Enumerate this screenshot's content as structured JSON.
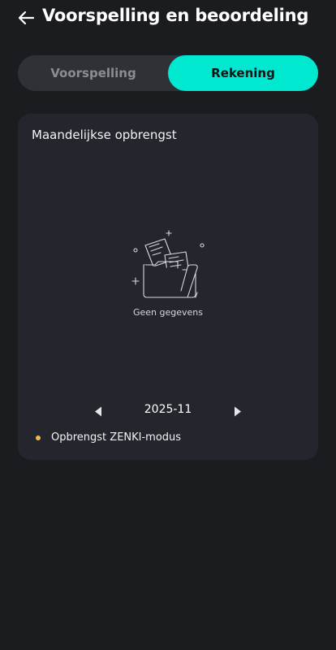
{
  "header": {
    "title": "Voorspelling en beoordeling",
    "back_icon": "arrow-left-icon"
  },
  "tabs": [
    {
      "label": "Voorspelling",
      "active": false
    },
    {
      "label": "Rekening",
      "active": true
    }
  ],
  "card": {
    "title": "Maandelijkse opbrengst",
    "empty_icon": "empty-folder-icon",
    "empty_text": "Geen gegevens",
    "month": "2025-11",
    "legend": [
      {
        "label": "Opbrengst ZENKI-modus",
        "color": "#f2b84b"
      }
    ]
  },
  "colors": {
    "background": "#1a1c20",
    "card": "#23272d",
    "accent": "#00e8cf",
    "segment_bg": "#2e3136"
  }
}
